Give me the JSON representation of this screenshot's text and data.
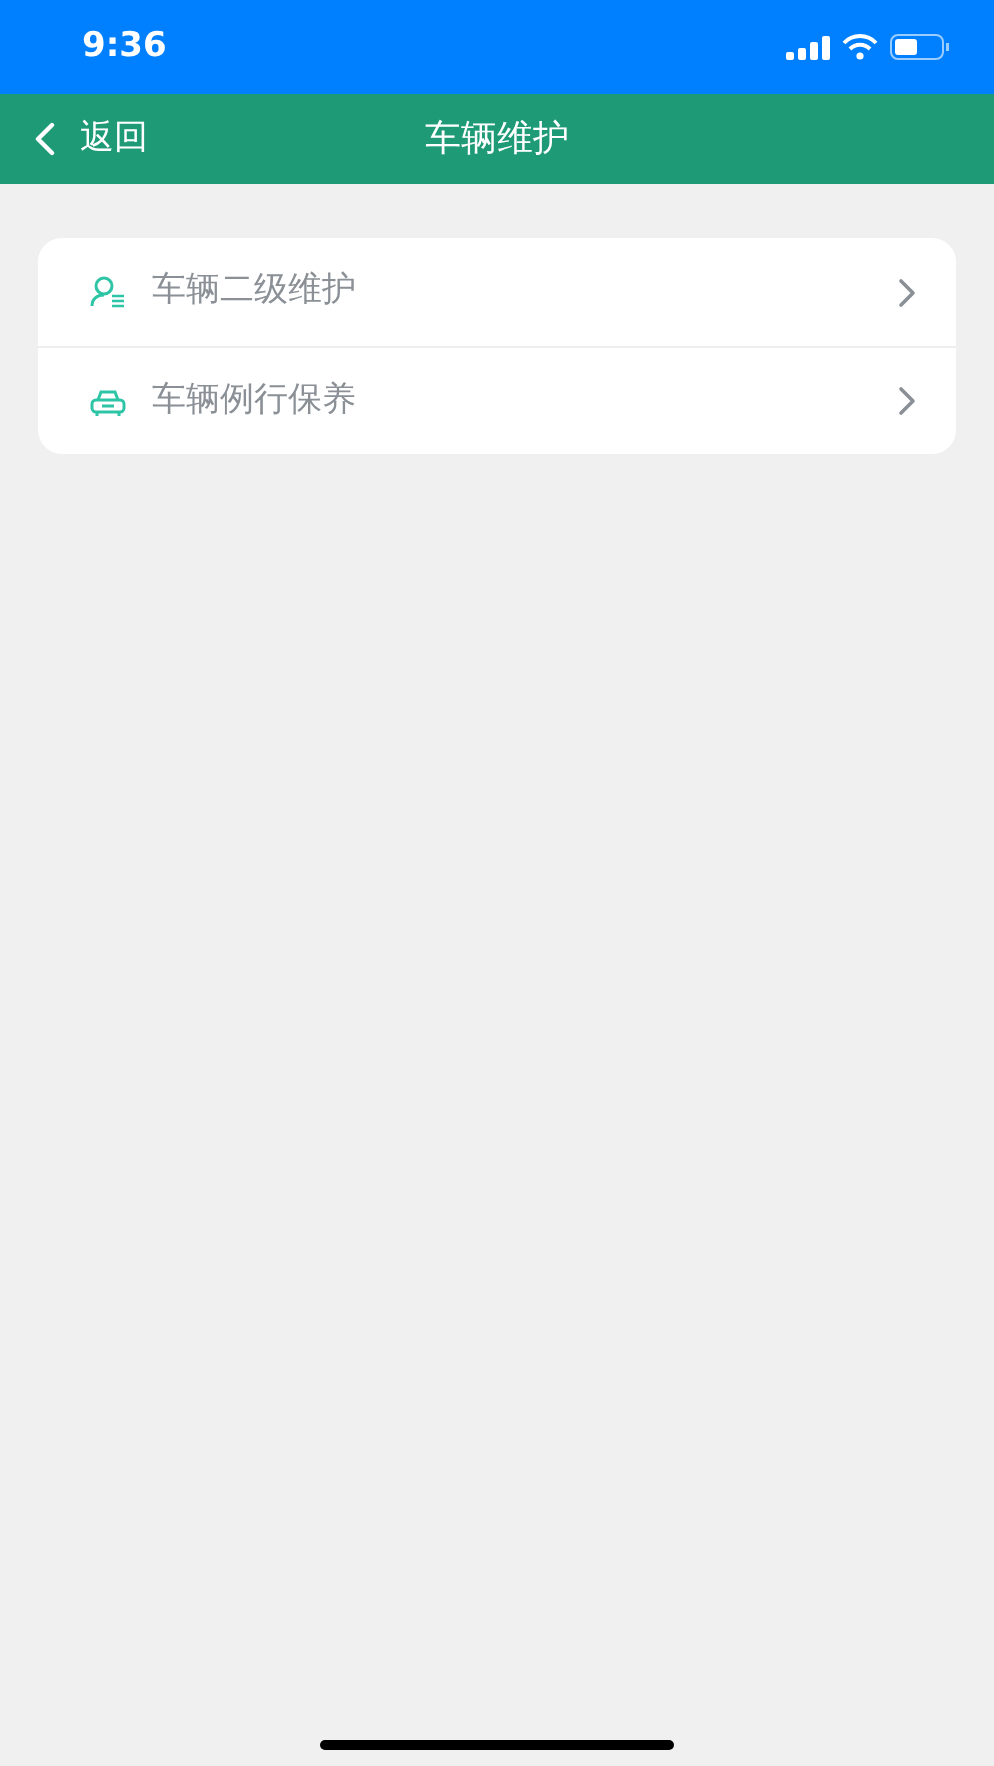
{
  "status_bar": {
    "time": "9:36"
  },
  "nav_bar": {
    "back_label": "返回",
    "title": "车辆维护"
  },
  "menu": [
    {
      "kind": "person",
      "label": "车辆二级维护"
    },
    {
      "kind": "car",
      "label": "车辆例行保养"
    }
  ]
}
